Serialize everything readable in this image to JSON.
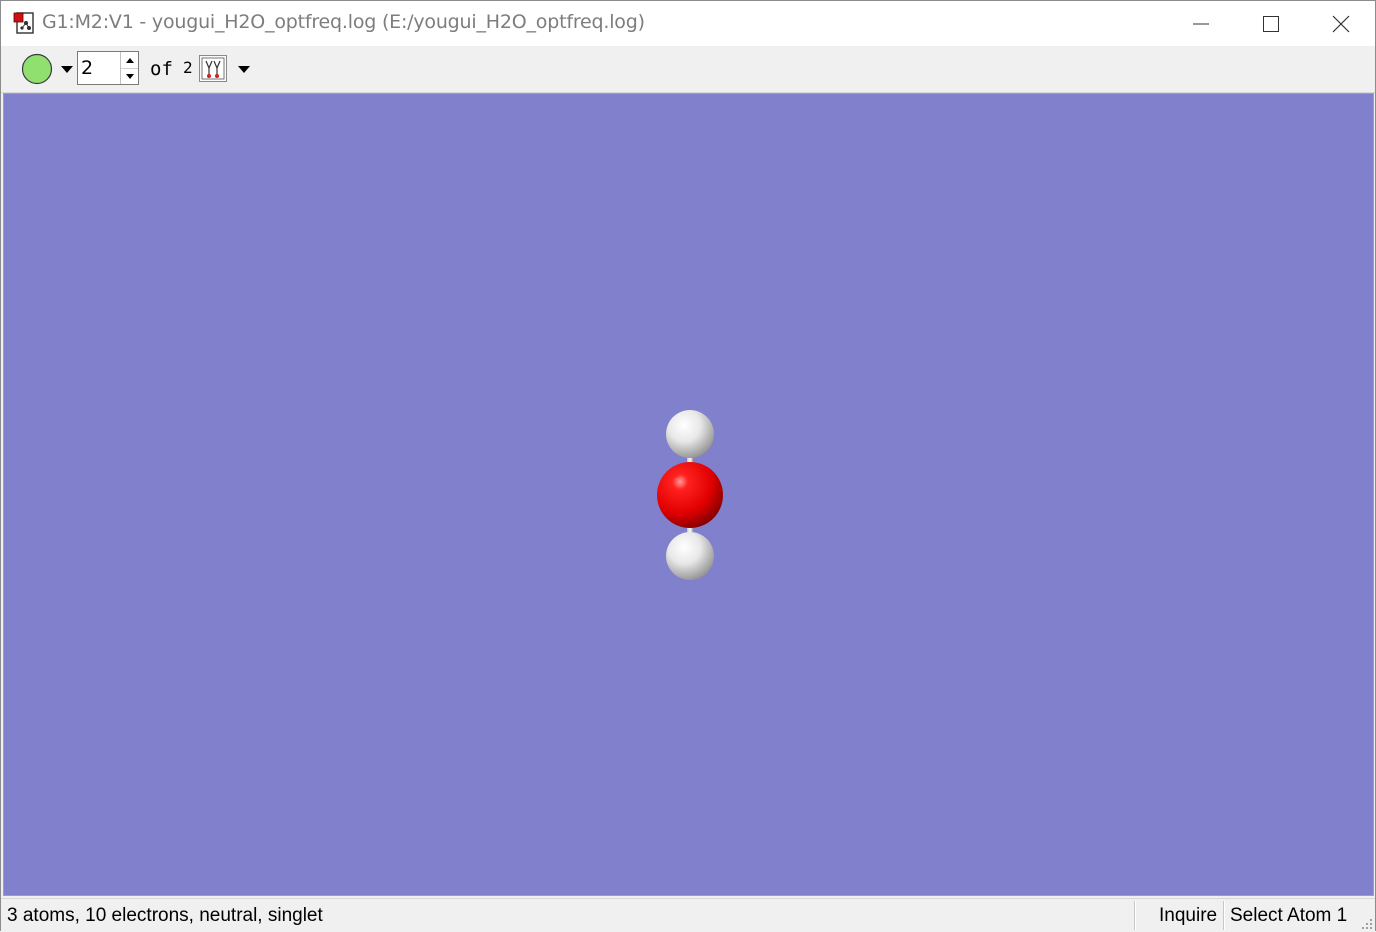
{
  "window": {
    "title": "G1:M2:V1 - yougui_H2O_optfreq.log (E:/yougui_H2O_optfreq.log)",
    "app_icon": "document-molecule-icon",
    "controls": [
      "minimize-icon",
      "maximize-icon",
      "close-icon"
    ]
  },
  "toolbar": {
    "model_indicator_color": "#90e070",
    "model_indicator_icon": "green-circle-icon",
    "current_structure": "2",
    "of_label": "of",
    "total_structures": "2",
    "animation_icon": "animation-icon"
  },
  "viewport": {
    "background": "#8080cc",
    "molecule": {
      "atoms": [
        {
          "element": "H",
          "color": "#ffffff"
        },
        {
          "element": "O",
          "color": "#ff0000"
        },
        {
          "element": "H",
          "color": "#ffffff"
        }
      ],
      "bonds": [
        [
          0,
          1
        ],
        [
          1,
          2
        ]
      ]
    }
  },
  "statusbar": {
    "info": "3 atoms, 10 electrons, neutral, singlet",
    "mode": "Inquire",
    "action": "Select Atom 1"
  }
}
